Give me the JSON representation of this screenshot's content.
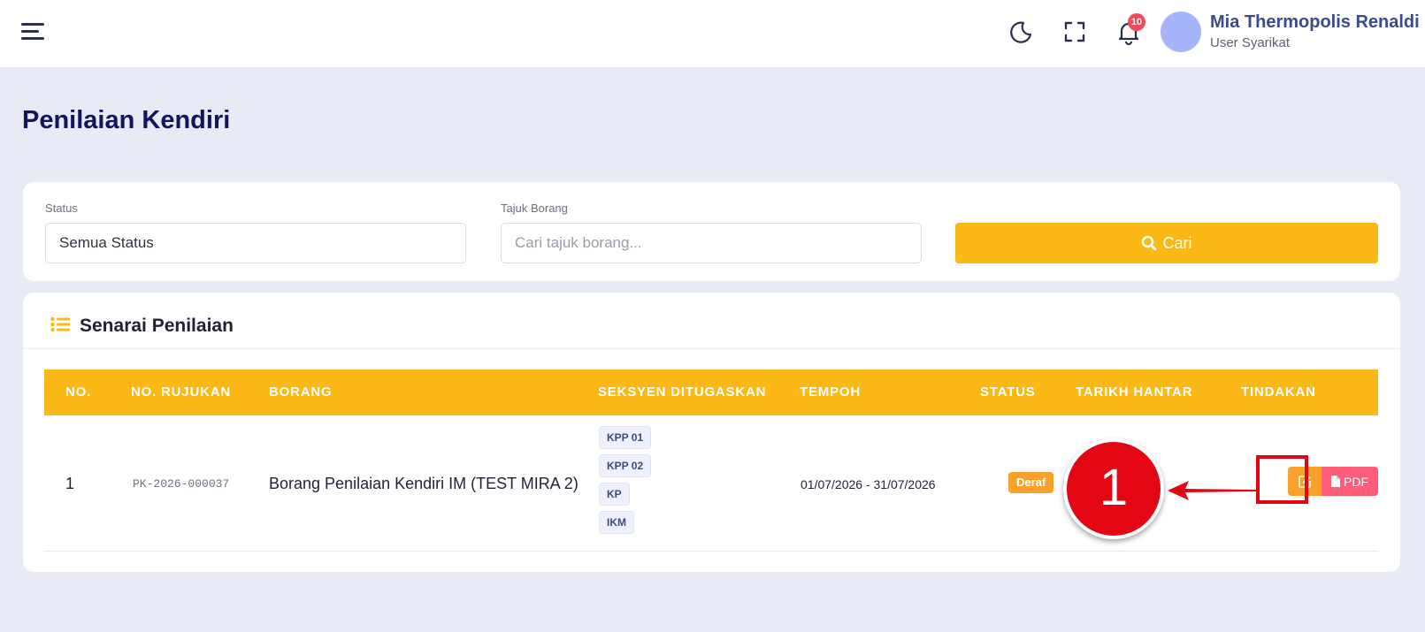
{
  "header": {
    "notification_count": "10",
    "user_name": "Mia Thermopolis Renaldi",
    "user_role": "User Syarikat"
  },
  "page": {
    "title": "Penilaian Kendiri"
  },
  "filters": {
    "status_label": "Status",
    "status_value": "Semua Status",
    "tajuk_label": "Tajuk Borang",
    "tajuk_placeholder": "Cari tajuk borang...",
    "search_button": "Cari"
  },
  "list": {
    "title": "Senarai Penilaian",
    "columns": [
      "NO.",
      "NO. RUJUKAN",
      "BORANG",
      "SEKSYEN DITUGASKAN",
      "TEMPOH",
      "STATUS",
      "TARIKH HANTAR",
      "TINDAKAN"
    ],
    "rows": [
      {
        "no": "1",
        "rujukan": "PK-2026-000037",
        "borang": "Borang Penilaian Kendiri IM (TEST MIRA 2)",
        "seksyen": [
          "KPP 01",
          "KPP 02",
          "KP",
          "IKM"
        ],
        "tempoh": "01/07/2026 - 31/07/2026",
        "status": "Deraf",
        "tarikh_hantar": "",
        "pdf_label": "PDF"
      }
    ]
  },
  "annotation": {
    "step": "1"
  },
  "colors": {
    "accent": "#fbb817",
    "title": "#14135e",
    "status_draft": "#f9a12a",
    "pdf": "#ff5c7a",
    "annotation": "#e30613"
  }
}
